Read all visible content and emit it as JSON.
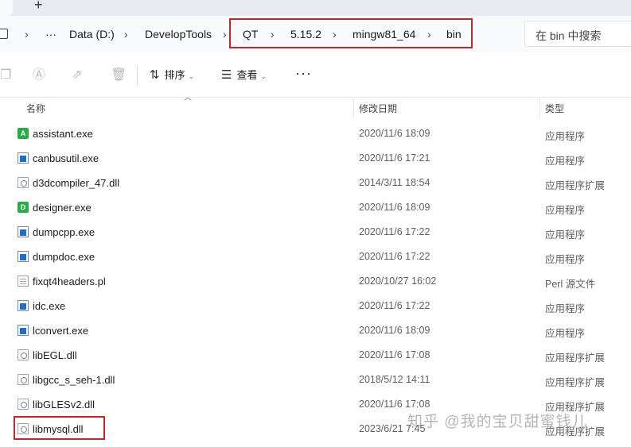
{
  "tabbar": {
    "new_tab": "+"
  },
  "breadcrumb": {
    "more": "···",
    "items": [
      "Data (D:)",
      "DevelopTools",
      "QT",
      "5.15.2",
      "mingw81_64",
      "bin"
    ],
    "separator": "›"
  },
  "search": {
    "placeholder": "在 bin 中搜索"
  },
  "toolbar": {
    "sort_label": "排序",
    "view_label": "查看",
    "more_label": "···"
  },
  "columns": {
    "name": "名称",
    "modified": "修改日期",
    "type": "类型"
  },
  "files": [
    {
      "name": "assistant.exe",
      "modified": "2020/11/6 18:09",
      "type": "应用程序",
      "icon": "qt-assistant-icon"
    },
    {
      "name": "canbusutil.exe",
      "modified": "2020/11/6 17:21",
      "type": "应用程序",
      "icon": "exe-icon"
    },
    {
      "name": "d3dcompiler_47.dll",
      "modified": "2014/3/11 18:54",
      "type": "应用程序扩展",
      "icon": "dll-icon"
    },
    {
      "name": "designer.exe",
      "modified": "2020/11/6 18:09",
      "type": "应用程序",
      "icon": "qt-designer-icon"
    },
    {
      "name": "dumpcpp.exe",
      "modified": "2020/11/6 17:22",
      "type": "应用程序",
      "icon": "exe-icon"
    },
    {
      "name": "dumpdoc.exe",
      "modified": "2020/11/6 17:22",
      "type": "应用程序",
      "icon": "exe-icon"
    },
    {
      "name": "fixqt4headers.pl",
      "modified": "2020/10/27 16:02",
      "type": "Perl 源文件",
      "icon": "script-icon"
    },
    {
      "name": "idc.exe",
      "modified": "2020/11/6 17:22",
      "type": "应用程序",
      "icon": "exe-icon"
    },
    {
      "name": "lconvert.exe",
      "modified": "2020/11/6 18:09",
      "type": "应用程序",
      "icon": "exe-icon"
    },
    {
      "name": "libEGL.dll",
      "modified": "2020/11/6 17:08",
      "type": "应用程序扩展",
      "icon": "dll-icon"
    },
    {
      "name": "libgcc_s_seh-1.dll",
      "modified": "2018/5/12 14:11",
      "type": "应用程序扩展",
      "icon": "dll-icon"
    },
    {
      "name": "libGLESv2.dll",
      "modified": "2020/11/6 17:08",
      "type": "应用程序扩展",
      "icon": "dll-icon"
    },
    {
      "name": "libmysql.dll",
      "modified": "2023/6/21 7:45",
      "type": "应用程序扩展",
      "icon": "dll-icon"
    }
  ],
  "watermark": "知乎 @我的宝贝甜蜜钱儿",
  "colors": {
    "highlight": "#c0282e",
    "accent": "#1f6fc5",
    "qt_green": "#2ea84a"
  }
}
